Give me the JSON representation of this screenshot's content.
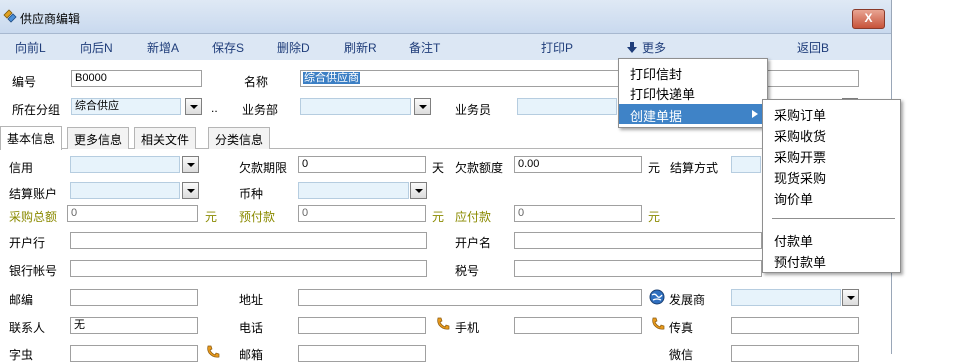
{
  "window": {
    "title": "供应商编辑",
    "close_label": "X"
  },
  "toolbar": {
    "prev": "向前L",
    "next": "向后N",
    "add": "新增A",
    "save": "保存S",
    "delete": "删除D",
    "refresh": "刷新R",
    "note": "备注T",
    "print": "打印P",
    "more": "更多",
    "back": "返回B"
  },
  "header": {
    "code_label": "编号",
    "code_value": "B0000",
    "name_label": "名称",
    "name_value": "综合供应商",
    "group_label": "所在分组",
    "group_value": "综合供应",
    "group_more": "..",
    "dept_label": "业务部",
    "staff_label": "业务员"
  },
  "tabs": [
    "基本信息",
    "更多信息",
    "相关文件",
    "分类信息"
  ],
  "form": {
    "credit_label": "信用",
    "overdue_days_label": "欠款期限",
    "overdue_days_value": "0",
    "day_unit": "天",
    "overdue_amount_label": "欠款额度",
    "overdue_amount_value": "0.00",
    "yuan_unit": "元",
    "settle_method_label": "结算方式",
    "settle_account_label": "结算账户",
    "currency_label": "币种",
    "purchase_total_label": "采购总额",
    "purchase_total_value": "0",
    "prepaid_label": "预付款",
    "prepaid_value": "0",
    "payable_label": "应付款",
    "payable_value": "0",
    "bank_label": "开户行",
    "account_name_label": "开户名",
    "bank_account_label": "银行帐号",
    "tax_id_label": "税号",
    "postcode_label": "邮编",
    "address_label": "地址",
    "developer_label": "发展商",
    "contact_label": "联系人",
    "contact_value": "无",
    "phone_label": "电话",
    "mobile_label": "手机",
    "fax_label": "传真",
    "row7_a": "字虫",
    "row7_b": "邮箱",
    "row7_c": "微信"
  },
  "more_menu": {
    "items": [
      "打印信封",
      "打印快递单",
      "创建单据"
    ]
  },
  "sub_menu": {
    "items": [
      "采购订单",
      "采购收货",
      "采购开票",
      "现货采购",
      "询价单",
      "付款单",
      "预付款单"
    ]
  },
  "colors": {
    "toolbar_text": "#1f3d7a",
    "highlight": "#3f83c7",
    "olive": "#8a8a00"
  },
  "icons": {
    "app": "app-icon",
    "phone": "phone-icon",
    "globe": "globe-icon",
    "more": "down-arrow-icon"
  }
}
